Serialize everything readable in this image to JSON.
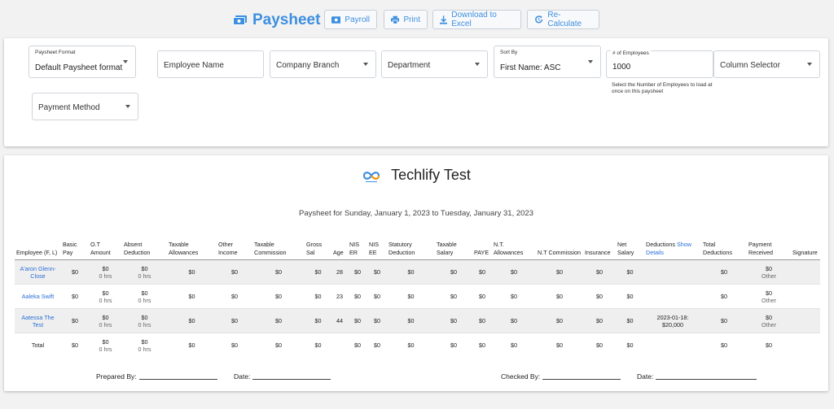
{
  "header": {
    "title": "Paysheet",
    "buttons": {
      "payroll": "Payroll",
      "print": "Print",
      "download": "Download to Excel",
      "recalc": "Re-Calculate"
    }
  },
  "filters": {
    "paysheet_format": {
      "label": "Paysheet Format",
      "value": "Default Paysheet format"
    },
    "employee_name": {
      "placeholder": "Employee Name"
    },
    "company_branch": {
      "placeholder": "Company Branch"
    },
    "department": {
      "placeholder": "Department"
    },
    "sort_by": {
      "label": "Sort By",
      "value": "First Name: ASC"
    },
    "employee_count": {
      "label": "# of Employees",
      "value": "1000",
      "helper": "Select the Number of Employees to load at once on this paysheet"
    },
    "column_selector": {
      "placeholder": "Column Selector"
    },
    "payment_method": {
      "placeholder": "Payment Method"
    }
  },
  "report": {
    "company": "Techlify Test",
    "period": "Paysheet for Sunday, January 1, 2023 to Tuesday, January 31, 2023",
    "columns": {
      "employee": "Employee (F, L)",
      "basic": "Basic Pay",
      "ot": "O.T Amount",
      "absent": "Absent Deduction",
      "tax_allow": "Taxable Allowances",
      "other_income": "Other Income",
      "tax_comm": "Taxable Commission",
      "gross": "Gross Sal",
      "age": "Age",
      "nis_er": "NIS ER",
      "nis_ee": "NIS EE",
      "stat_ded": "Statutory Deduction",
      "tax_salary": "Taxable Salary",
      "paye": "PAYE",
      "nt_allow": "N.T. Allowances",
      "nt_comm": "N.T Commission",
      "insurance": "Insurance",
      "net": "Net Salary",
      "deductions": "Deductions",
      "show": "Show",
      "details": "Details",
      "total_ded": "Total Deductions",
      "payment": "Payment Received",
      "signature": "Signature"
    },
    "rows": [
      {
        "name": "A'aron Glenn-Close",
        "basic": "$0",
        "ot": "$0",
        "ot_hrs": "0 hrs",
        "absent": "$0",
        "absent_hrs": "0 hrs",
        "tax_allow": "$0",
        "other_income": "$0",
        "tax_comm": "$0",
        "gross": "$0",
        "age": "28",
        "nis_er": "$0",
        "nis_ee": "$0",
        "stat_ded": "$0",
        "tax_salary": "$0",
        "paye": "$0",
        "nt_allow": "$0",
        "nt_comm": "$0",
        "insurance": "$0",
        "net": "$0",
        "deductions": "",
        "total_ded": "$0",
        "payment": "$0",
        "payment_method": "Other"
      },
      {
        "name": "Aaleka Swift",
        "basic": "$0",
        "ot": "$0",
        "ot_hrs": "0 hrs",
        "absent": "$0",
        "absent_hrs": "0 hrs",
        "tax_allow": "$0",
        "other_income": "$0",
        "tax_comm": "$0",
        "gross": "$0",
        "age": "23",
        "nis_er": "$0",
        "nis_ee": "$0",
        "stat_ded": "$0",
        "tax_salary": "$0",
        "paye": "$0",
        "nt_allow": "$0",
        "nt_comm": "$0",
        "insurance": "$0",
        "net": "$0",
        "deductions": "",
        "total_ded": "$0",
        "payment": "$0",
        "payment_method": "Other"
      },
      {
        "name": "Aatessa The Test",
        "basic": "$0",
        "ot": "$0",
        "ot_hrs": "0 hrs",
        "absent": "$0",
        "absent_hrs": "0 hrs",
        "tax_allow": "$0",
        "other_income": "$0",
        "tax_comm": "$0",
        "gross": "$0",
        "age": "44",
        "nis_er": "$0",
        "nis_ee": "$0",
        "stat_ded": "$0",
        "tax_salary": "$0",
        "paye": "$0",
        "nt_allow": "$0",
        "nt_comm": "$0",
        "insurance": "$0",
        "net": "$0",
        "deductions": "2023-01-18: $20,000",
        "total_ded": "$0",
        "payment": "$0",
        "payment_method": "Other"
      }
    ],
    "total": {
      "label": "Total",
      "basic": "$0",
      "ot": "$0",
      "ot_hrs": "0 hrs",
      "absent": "$0",
      "absent_hrs": "0 hrs",
      "tax_allow": "$0",
      "other_income": "$0",
      "tax_comm": "$0",
      "gross": "$0",
      "nis_er": "$0",
      "nis_ee": "$0",
      "stat_ded": "$0",
      "tax_salary": "$0",
      "paye": "$0",
      "nt_allow": "$0",
      "nt_comm": "$0",
      "insurance": "$0",
      "net": "$0",
      "total_ded": "$0",
      "payment": "$0"
    },
    "signatures": {
      "prepared": "Prepared By:",
      "date": "Date:",
      "checked": "Checked By:"
    }
  },
  "colors": {
    "accent": "#3d8fe0",
    "link": "#2a6fd6",
    "row_shade": "#efefef"
  }
}
